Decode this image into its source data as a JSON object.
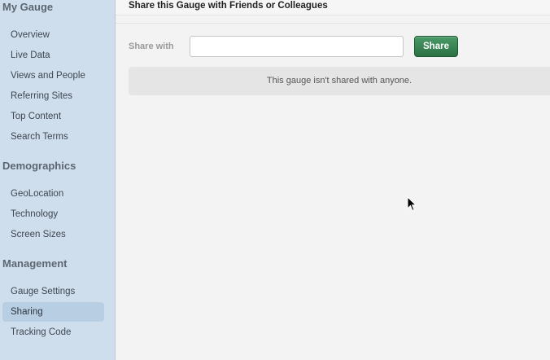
{
  "sidebar": {
    "sections": [
      {
        "title": "My Gauge",
        "items": [
          "Overview",
          "Live Data",
          "Views and People",
          "Referring Sites",
          "Top Content",
          "Search Terms"
        ]
      },
      {
        "title": "Demographics",
        "items": [
          "GeoLocation",
          "Technology",
          "Screen Sizes"
        ]
      },
      {
        "title": "Management",
        "items": [
          "Gauge Settings",
          "Sharing",
          "Tracking Code"
        ]
      }
    ],
    "active_item": "Sharing"
  },
  "main": {
    "title": "Share this Gauge with Friends or Colleagues",
    "share_label": "Share with",
    "share_input_value": "",
    "share_button_label": "Share",
    "empty_notice": "This gauge isn't shared with anyone."
  },
  "colors": {
    "sidebar_bg": "#cfdeed",
    "active_item_bg": "#b7cee3",
    "share_button": "#2e7a4a"
  }
}
